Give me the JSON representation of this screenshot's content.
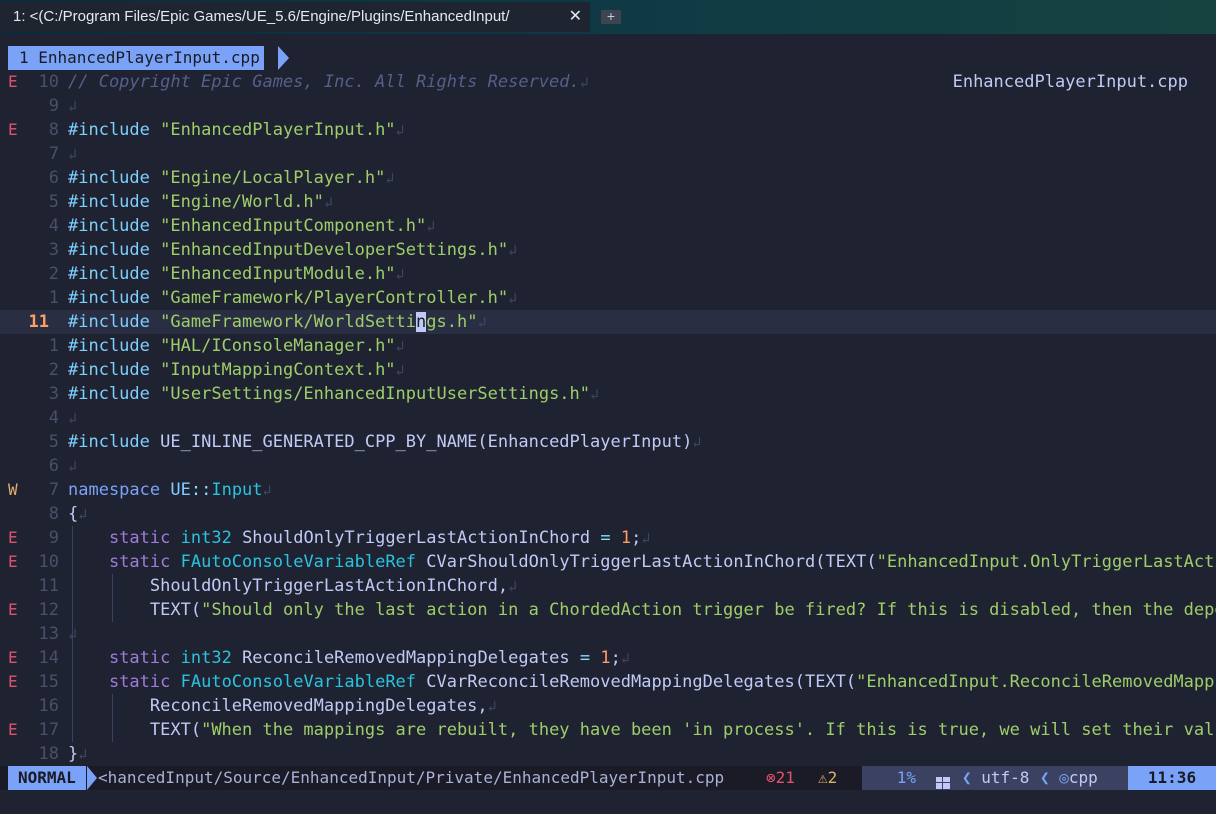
{
  "window": {
    "tab_title": "1: <(C:/Program Files/Epic Games/UE_5.6/Engine/Plugins/EnhancedInput/",
    "tab_close": "✕",
    "new_tab": "+"
  },
  "tabline": {
    "buffer_tab": "1 EnhancedPlayerInput.cpp"
  },
  "editor": {
    "float_filename": "EnhancedPlayerInput.cpp",
    "eol_glyph": "↲",
    "lines": [
      {
        "sign": "E",
        "num": "10"
      },
      {
        "sign": "",
        "num": "9"
      },
      {
        "sign": "E",
        "num": "8"
      },
      {
        "sign": "",
        "num": "7"
      },
      {
        "sign": "",
        "num": "6"
      },
      {
        "sign": "",
        "num": "5"
      },
      {
        "sign": "",
        "num": "4"
      },
      {
        "sign": "",
        "num": "3"
      },
      {
        "sign": "",
        "num": "2"
      },
      {
        "sign": "",
        "num": "1"
      },
      {
        "sign": "",
        "num": "11"
      },
      {
        "sign": "",
        "num": "1"
      },
      {
        "sign": "",
        "num": "2"
      },
      {
        "sign": "",
        "num": "3"
      },
      {
        "sign": "",
        "num": "4"
      },
      {
        "sign": "",
        "num": "5"
      },
      {
        "sign": "",
        "num": "6"
      },
      {
        "sign": "W",
        "num": "7"
      },
      {
        "sign": "",
        "num": "8"
      },
      {
        "sign": "E",
        "num": "9"
      },
      {
        "sign": "E",
        "num": "10"
      },
      {
        "sign": "",
        "num": "11"
      },
      {
        "sign": "E",
        "num": "12"
      },
      {
        "sign": "",
        "num": "13"
      },
      {
        "sign": "E",
        "num": "14"
      },
      {
        "sign": "E",
        "num": "15"
      },
      {
        "sign": "",
        "num": "16"
      },
      {
        "sign": "E",
        "num": "17"
      },
      {
        "sign": "",
        "num": "18"
      }
    ],
    "text": {
      "l0": "// Copyright Epic Games, Inc. All Rights Reserved.",
      "inc": "#include",
      "l2s": "\"EnhancedPlayerInput.h\"",
      "l4s": "\"Engine/LocalPlayer.h\"",
      "l5s": "\"Engine/World.h\"",
      "l6s": "\"EnhancedInputComponent.h\"",
      "l7s": "\"EnhancedInputDeveloperSettings.h\"",
      "l8s": "\"EnhancedInputModule.h\"",
      "l9s": "\"GameFramework/PlayerController.h\"",
      "l10a": "\"GameFramework/WorldSetti",
      "l10c": "n",
      "l10b": "gs.h\"",
      "l11s": "\"HAL/IConsoleManager.h\"",
      "l12s": "\"InputMappingContext.h\"",
      "l13s": "\"UserSettings/EnhancedInputUserSettings.h\"",
      "l15": "UE_INLINE_GENERATED_CPP_BY_NAME(EnhancedPlayerInput)",
      "namespace": "namespace",
      "ns_ue": "UE",
      "ns_sep": "::",
      "ns_input": "Input",
      "brace_open": "{",
      "brace_close": "}",
      "static": "static",
      "int32": "int32",
      "l19var": "ShouldOnlyTriggerLastActionInChord",
      "eq": "=",
      "one": "1",
      "semi": ";",
      "fauto": "FAutoConsoleVariableRef",
      "l20var": "CVarShouldOnlyTriggerLastActionInChord(TEXT(",
      "l20str": "\"EnhancedInput.OnlyTriggerLastActio",
      "l21": "ShouldOnlyTriggerLastActionInChord,",
      "text_open": "TEXT(",
      "l22str": "\"Should only the last action in a ChordedAction trigger be fired? If this is disabled, then the depen",
      "l24var": "ReconcileRemovedMappingDelegates",
      "l25var": "CVarReconcileRemovedMappingDelegates(TEXT(",
      "l25str": "\"EnhancedInput.ReconcileRemovedMappin",
      "l26": "ReconcileRemovedMappingDelegates,",
      "l27str": "\"When the mappings are rebuilt, they have been 'in process'. If this is true, we will set their value"
    }
  },
  "statusline": {
    "mode": "NORMAL",
    "path": "<hancedInput/Source/EnhancedInput/Private/EnhancedPlayerInput.cpp",
    "errors_icon": "⊗",
    "errors": "21",
    "warnings_icon": "⚠",
    "warnings": "2",
    "percent": "1%",
    "encoding": "utf-8",
    "filetype": "cpp",
    "filetype_icon": "◎",
    "time": "11:36"
  }
}
